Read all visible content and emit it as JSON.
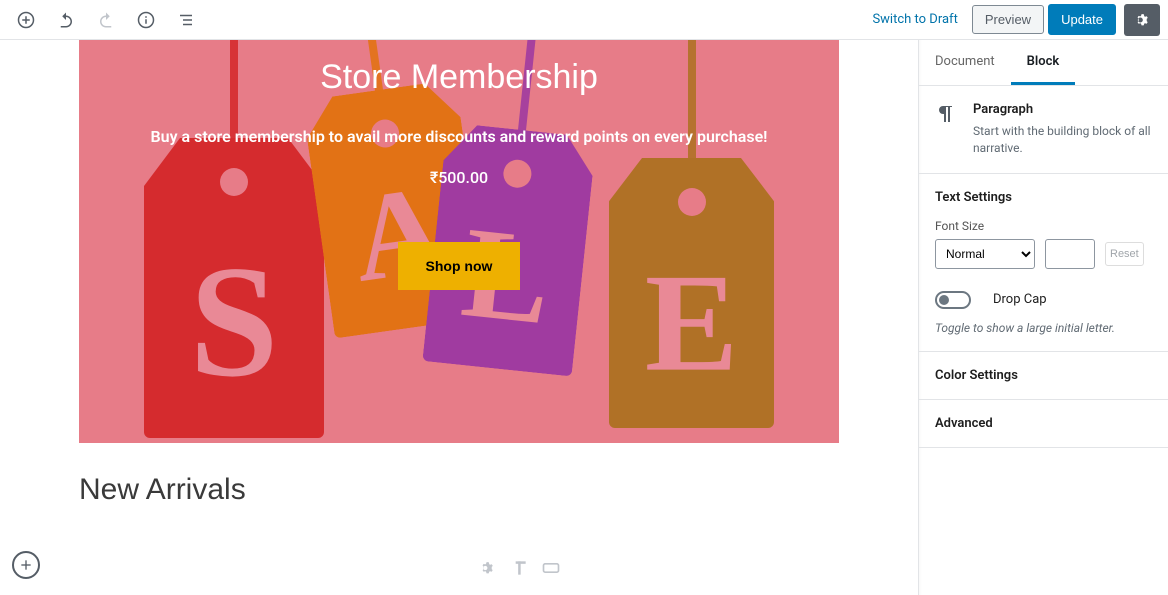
{
  "toolbar": {
    "switch_to_draft": "Switch to Draft",
    "preview": "Preview",
    "update": "Update"
  },
  "cover": {
    "title": "Store Membership",
    "subtitle": "Buy a store membership to avail more discounts and reward points on every purchase!",
    "price": "₹500.00",
    "cta": "Shop now",
    "tag_letters": {
      "s": "S",
      "a": "A",
      "l": "L",
      "e": "E"
    }
  },
  "heading": {
    "new_arrivals": "New Arrivals"
  },
  "sidebar": {
    "tabs": {
      "document": "Document",
      "block": "Block"
    },
    "block_card": {
      "title": "Paragraph",
      "description": "Start with the building block of all narrative."
    },
    "text_settings": {
      "title": "Text Settings",
      "font_size_label": "Font Size",
      "font_size_value": "Normal",
      "reset": "Reset",
      "drop_cap_label": "Drop Cap",
      "drop_cap_help": "Toggle to show a large initial letter."
    },
    "color_settings": {
      "title": "Color Settings"
    },
    "advanced": {
      "title": "Advanced"
    }
  }
}
